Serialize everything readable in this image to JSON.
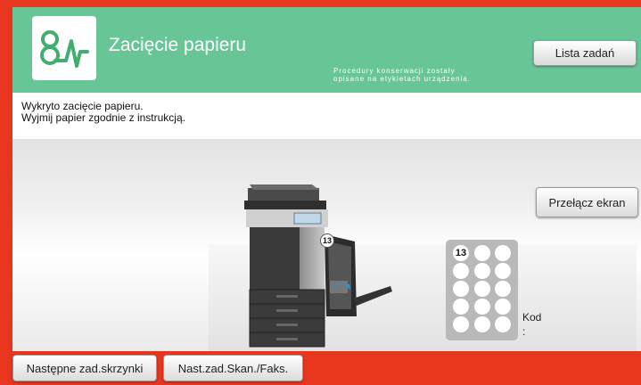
{
  "header": {
    "title": "Zacięcie papieru",
    "note": "Procedury konserwacji zostały\nopisane na etykietach urządzenia.",
    "job_list_button": "Lista zadań",
    "app_icon": "jam-waveform-icon"
  },
  "message": {
    "line1": "Wykryto zacięcie papieru.",
    "line2": "Wyjmij papier zgodnie z instrukcją."
  },
  "main": {
    "switch_screen_button": "Przełącz ekran",
    "jam_marker_number": "13",
    "code_panel": {
      "highlighted_number": "13",
      "code_label": "Kod",
      "code_colon": ":"
    }
  },
  "bottom": {
    "next_box_jobs_button": "Następne zad.skrzynki",
    "next_scan_fax_button": "Nast.zad.Skan./Faks."
  },
  "colors": {
    "frame": "#e8361e",
    "header": "#68c596",
    "icon_accent": "#3fae6f"
  }
}
